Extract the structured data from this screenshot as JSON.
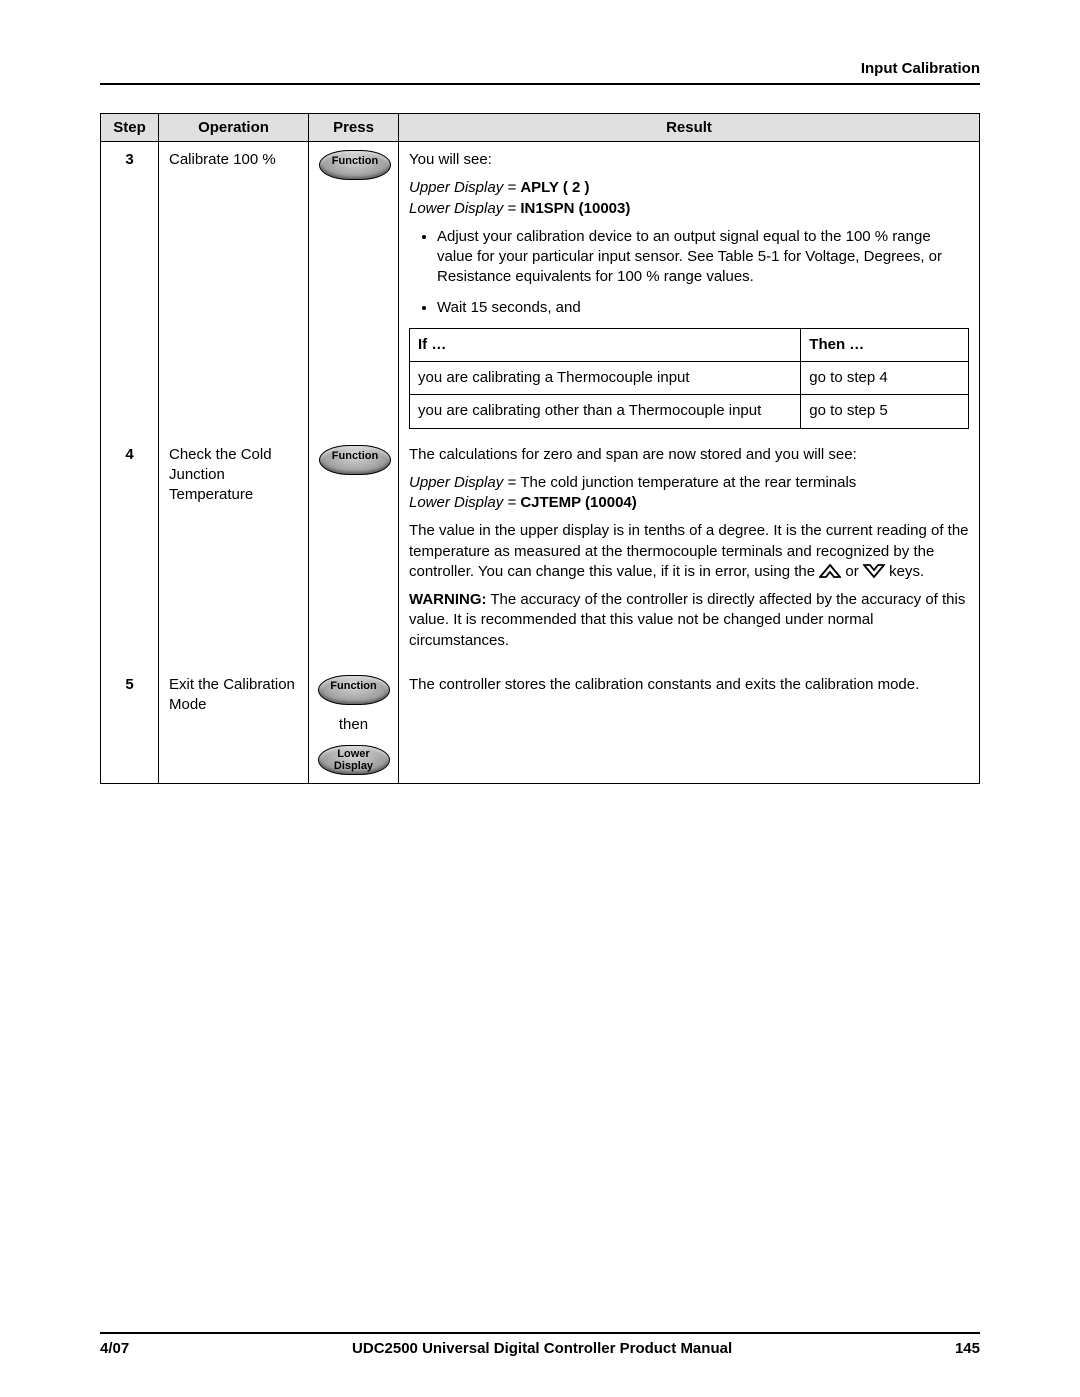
{
  "header": {
    "section_title": "Input Calibration"
  },
  "table": {
    "headers": {
      "step": "Step",
      "operation": "Operation",
      "press": "Press",
      "result": "Result"
    },
    "rows": [
      {
        "step": "3",
        "operation": "Calibrate 100 %",
        "press": {
          "key1": "Function"
        },
        "result": {
          "intro": "You will see:",
          "upper_display_label": "Upper Display = ",
          "upper_display_value": "APLY ( 2 )",
          "lower_display_label": "Lower Display = ",
          "lower_display_value": "IN1SPN (10003)",
          "bullet1": "Adjust your calibration device to an output signal equal to the 100 % range value for your particular input sensor. See Table 5-1 for Voltage, Degrees, or Resistance equivalents for 100 % range values.",
          "bullet2": "Wait 15 seconds, and",
          "if_then": {
            "if_header": "If …",
            "then_header": "Then …",
            "rows": [
              {
                "if": "you are calibrating a Thermocouple input",
                "then": "go to step 4"
              },
              {
                "if": "you are calibrating other than a Thermocouple input",
                "then": "go to step 5"
              }
            ]
          }
        }
      },
      {
        "step": "4",
        "operation": "Check the Cold Junction Temperature",
        "press": {
          "key1": "Function"
        },
        "result": {
          "p1": "The calculations for zero and span are now stored and you will see:",
          "upper_display_label": "Upper Display = ",
          "upper_display_value": "The cold junction temperature at the rear terminals",
          "lower_display_label": "Lower Display = ",
          "lower_display_value": "CJTEMP (10004)",
          "p2a": "The value in the upper display is in tenths of a degree. It is the current reading of the temperature as measured at the thermocouple terminals and recognized by the controller. You can change this value, if it is in error, using the ",
          "or_word": " or ",
          "p2b": " keys.",
          "warning_label": "WARNING:",
          "warning_text": " The accuracy of the controller is directly affected by the accuracy of this value.  It is recommended that this value not be changed under normal circumstances."
        }
      },
      {
        "step": "5",
        "operation": "Exit the Calibration Mode",
        "press": {
          "key1": "Function",
          "then_word": "then",
          "key2_l1": "Lower",
          "key2_l2": "Display"
        },
        "result": {
          "p1": "The controller stores the calibration constants and exits the calibration mode."
        }
      }
    ]
  },
  "footer": {
    "date": "4/07",
    "title": "UDC2500 Universal Digital Controller Product Manual",
    "page": "145"
  }
}
